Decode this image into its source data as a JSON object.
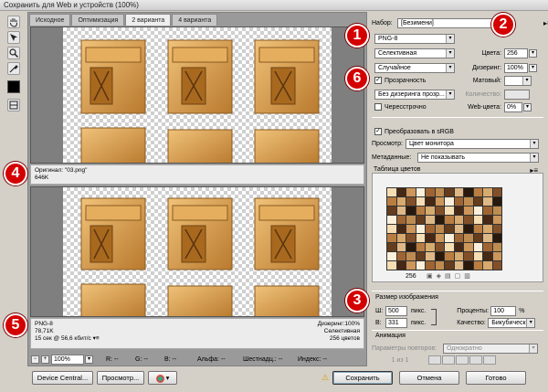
{
  "window": {
    "title": "Сохранить для Web и устройств (100%)"
  },
  "tabs": [
    "Исходное",
    "Оптимизация",
    "2 варианта",
    "4 варианта"
  ],
  "tools": {
    "hand": "hand-icon",
    "slice_select": "slice-select-icon",
    "zoom": "zoom-icon",
    "eyedropper": "eyedropper-icon",
    "eyedropper_color": "#000000",
    "slice_toggle": "toggle-slices-icon"
  },
  "top_pane": {
    "label": "Оригинал: \"03.png\"",
    "size": "646K"
  },
  "bottom_pane": {
    "left": [
      "PNG-8",
      "78,71K",
      "15 сек @ 56,6 кбит/с"
    ],
    "right": [
      "Дизеринг:100%",
      "Селективная",
      "256 цветов"
    ]
  },
  "badges": [
    "1",
    "2",
    "3",
    "4",
    "5",
    "6"
  ],
  "settings": {
    "preset_label": "Набор:",
    "preset_value": "[Безимени]",
    "format": "PNG-8",
    "reduction": "Селективная",
    "colors_label": "Цвета:",
    "colors_value": "256",
    "dither_algo": "Случайное",
    "dither_label": "Дизеринг:",
    "dither_value": "100%",
    "transparency_label": "Прозрачность",
    "matte_label": "Матовый:",
    "transparency_dither": "Без дизеринга прозр...",
    "amount_label": "Количество:",
    "interlaced_label": "Чересстрочно",
    "web_snap_label": "Web-цвета:",
    "web_snap_value": "0%",
    "srgb_label": "Преобразовать в sRGB",
    "preview_label": "Просмотр:",
    "preview_value": "Цвет монитора",
    "metadata_label": "Метаданные:",
    "metadata_value": "Не показывать"
  },
  "color_table": {
    "title": "Таблица цветов",
    "count": "256"
  },
  "image_size": {
    "title": "Размер изображения",
    "w_label": "Ш:",
    "w_value": "500",
    "w_unit": "пикс.",
    "h_label": "В:",
    "h_value": "331",
    "h_unit": "пикс.",
    "percent_label": "Проценты:",
    "percent_value": "100",
    "percent_unit": "%",
    "quality_label": "Качество:",
    "quality_value": "Бикубическая"
  },
  "animation": {
    "title": "Анимация",
    "loop_label": "Параметры повторов:",
    "loop_value": "Однократно",
    "frames": "1 из 1"
  },
  "status": {
    "zoom": "100%",
    "r": "R: --",
    "g": "G: --",
    "b": "B: --",
    "alpha": "Альфа: --",
    "hex": "Шестнадц.: --",
    "index": "Индекс: --"
  },
  "buttons": {
    "device_central": "Device Central...",
    "preview": "Просмотр...",
    "save": "Сохранить",
    "cancel": "Отмена",
    "done": "Готово"
  }
}
